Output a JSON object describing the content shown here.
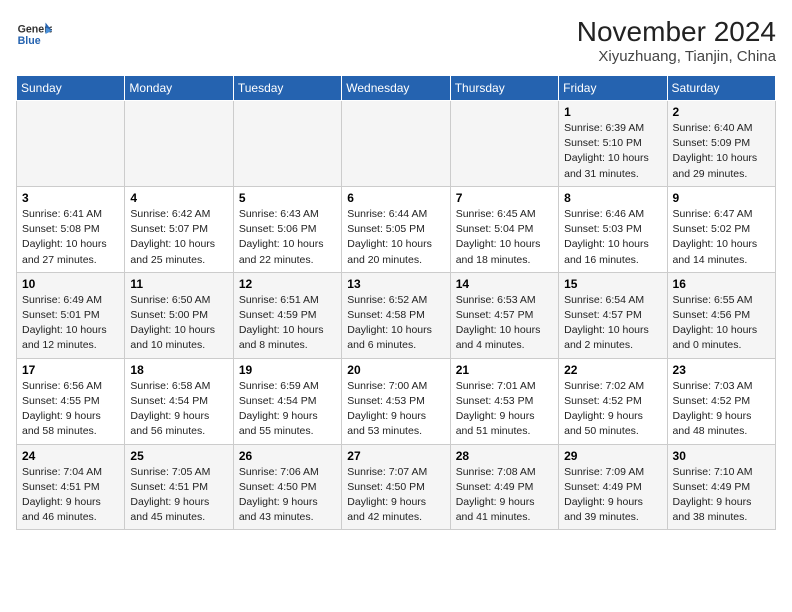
{
  "header": {
    "logo": {
      "line1": "General",
      "line2": "Blue"
    },
    "title": "November 2024",
    "subtitle": "Xiyuzhuang, Tianjin, China"
  },
  "weekdays": [
    "Sunday",
    "Monday",
    "Tuesday",
    "Wednesday",
    "Thursday",
    "Friday",
    "Saturday"
  ],
  "weeks": [
    [
      {
        "day": "",
        "info": ""
      },
      {
        "day": "",
        "info": ""
      },
      {
        "day": "",
        "info": ""
      },
      {
        "day": "",
        "info": ""
      },
      {
        "day": "",
        "info": ""
      },
      {
        "day": "1",
        "info": "Sunrise: 6:39 AM\nSunset: 5:10 PM\nDaylight: 10 hours\nand 31 minutes."
      },
      {
        "day": "2",
        "info": "Sunrise: 6:40 AM\nSunset: 5:09 PM\nDaylight: 10 hours\nand 29 minutes."
      }
    ],
    [
      {
        "day": "3",
        "info": "Sunrise: 6:41 AM\nSunset: 5:08 PM\nDaylight: 10 hours\nand 27 minutes."
      },
      {
        "day": "4",
        "info": "Sunrise: 6:42 AM\nSunset: 5:07 PM\nDaylight: 10 hours\nand 25 minutes."
      },
      {
        "day": "5",
        "info": "Sunrise: 6:43 AM\nSunset: 5:06 PM\nDaylight: 10 hours\nand 22 minutes."
      },
      {
        "day": "6",
        "info": "Sunrise: 6:44 AM\nSunset: 5:05 PM\nDaylight: 10 hours\nand 20 minutes."
      },
      {
        "day": "7",
        "info": "Sunrise: 6:45 AM\nSunset: 5:04 PM\nDaylight: 10 hours\nand 18 minutes."
      },
      {
        "day": "8",
        "info": "Sunrise: 6:46 AM\nSunset: 5:03 PM\nDaylight: 10 hours\nand 16 minutes."
      },
      {
        "day": "9",
        "info": "Sunrise: 6:47 AM\nSunset: 5:02 PM\nDaylight: 10 hours\nand 14 minutes."
      }
    ],
    [
      {
        "day": "10",
        "info": "Sunrise: 6:49 AM\nSunset: 5:01 PM\nDaylight: 10 hours\nand 12 minutes."
      },
      {
        "day": "11",
        "info": "Sunrise: 6:50 AM\nSunset: 5:00 PM\nDaylight: 10 hours\nand 10 minutes."
      },
      {
        "day": "12",
        "info": "Sunrise: 6:51 AM\nSunset: 4:59 PM\nDaylight: 10 hours\nand 8 minutes."
      },
      {
        "day": "13",
        "info": "Sunrise: 6:52 AM\nSunset: 4:58 PM\nDaylight: 10 hours\nand 6 minutes."
      },
      {
        "day": "14",
        "info": "Sunrise: 6:53 AM\nSunset: 4:57 PM\nDaylight: 10 hours\nand 4 minutes."
      },
      {
        "day": "15",
        "info": "Sunrise: 6:54 AM\nSunset: 4:57 PM\nDaylight: 10 hours\nand 2 minutes."
      },
      {
        "day": "16",
        "info": "Sunrise: 6:55 AM\nSunset: 4:56 PM\nDaylight: 10 hours\nand 0 minutes."
      }
    ],
    [
      {
        "day": "17",
        "info": "Sunrise: 6:56 AM\nSunset: 4:55 PM\nDaylight: 9 hours\nand 58 minutes."
      },
      {
        "day": "18",
        "info": "Sunrise: 6:58 AM\nSunset: 4:54 PM\nDaylight: 9 hours\nand 56 minutes."
      },
      {
        "day": "19",
        "info": "Sunrise: 6:59 AM\nSunset: 4:54 PM\nDaylight: 9 hours\nand 55 minutes."
      },
      {
        "day": "20",
        "info": "Sunrise: 7:00 AM\nSunset: 4:53 PM\nDaylight: 9 hours\nand 53 minutes."
      },
      {
        "day": "21",
        "info": "Sunrise: 7:01 AM\nSunset: 4:53 PM\nDaylight: 9 hours\nand 51 minutes."
      },
      {
        "day": "22",
        "info": "Sunrise: 7:02 AM\nSunset: 4:52 PM\nDaylight: 9 hours\nand 50 minutes."
      },
      {
        "day": "23",
        "info": "Sunrise: 7:03 AM\nSunset: 4:52 PM\nDaylight: 9 hours\nand 48 minutes."
      }
    ],
    [
      {
        "day": "24",
        "info": "Sunrise: 7:04 AM\nSunset: 4:51 PM\nDaylight: 9 hours\nand 46 minutes."
      },
      {
        "day": "25",
        "info": "Sunrise: 7:05 AM\nSunset: 4:51 PM\nDaylight: 9 hours\nand 45 minutes."
      },
      {
        "day": "26",
        "info": "Sunrise: 7:06 AM\nSunset: 4:50 PM\nDaylight: 9 hours\nand 43 minutes."
      },
      {
        "day": "27",
        "info": "Sunrise: 7:07 AM\nSunset: 4:50 PM\nDaylight: 9 hours\nand 42 minutes."
      },
      {
        "day": "28",
        "info": "Sunrise: 7:08 AM\nSunset: 4:49 PM\nDaylight: 9 hours\nand 41 minutes."
      },
      {
        "day": "29",
        "info": "Sunrise: 7:09 AM\nSunset: 4:49 PM\nDaylight: 9 hours\nand 39 minutes."
      },
      {
        "day": "30",
        "info": "Sunrise: 7:10 AM\nSunset: 4:49 PM\nDaylight: 9 hours\nand 38 minutes."
      }
    ]
  ]
}
